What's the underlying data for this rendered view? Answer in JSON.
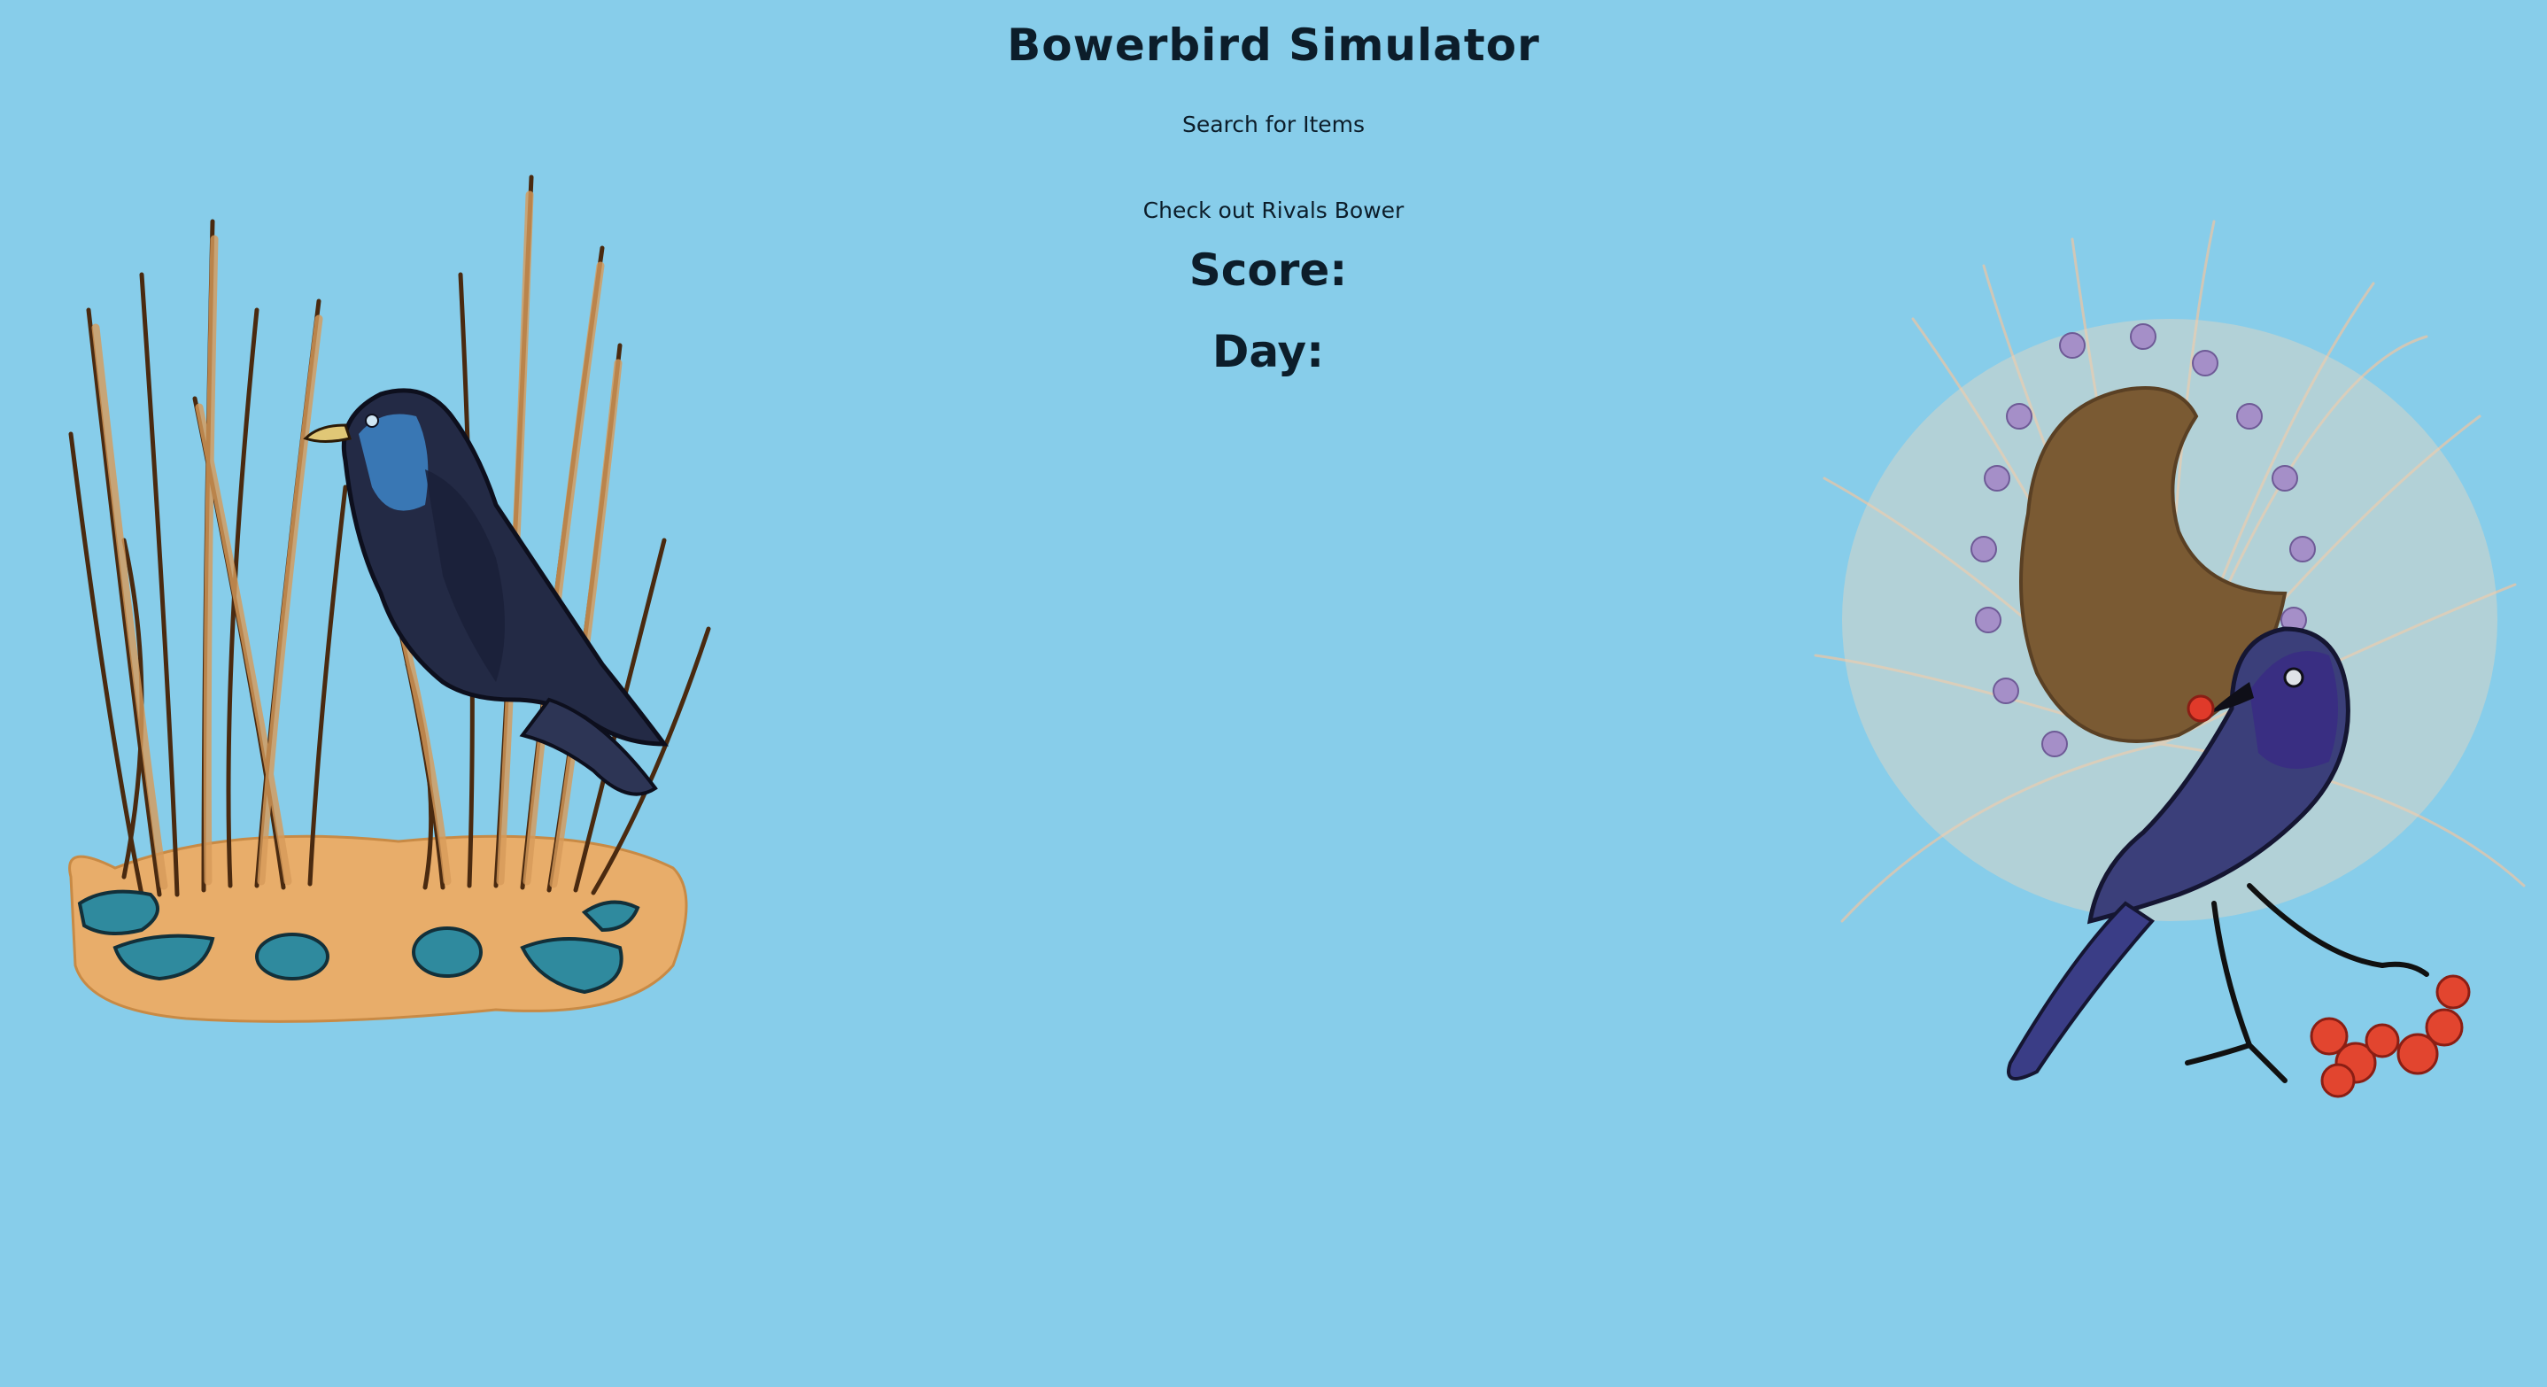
{
  "header": {
    "title": "Bowerbird Simulator"
  },
  "actions": {
    "search_label": "Search for Items",
    "rival_label": "Check out Rivals Bower"
  },
  "stats": {
    "score_label": "Score:",
    "score_value": "",
    "day_label": "Day:",
    "day_value": ""
  },
  "illustrations": {
    "player_bower": "satin-bowerbird-with-stick-bower-and-blue-items",
    "rival_bower": "bowerbird-with-flower-decorated-nest-and-red-berries"
  },
  "colors": {
    "background": "#87cdea",
    "text": "#0c1d2a"
  }
}
